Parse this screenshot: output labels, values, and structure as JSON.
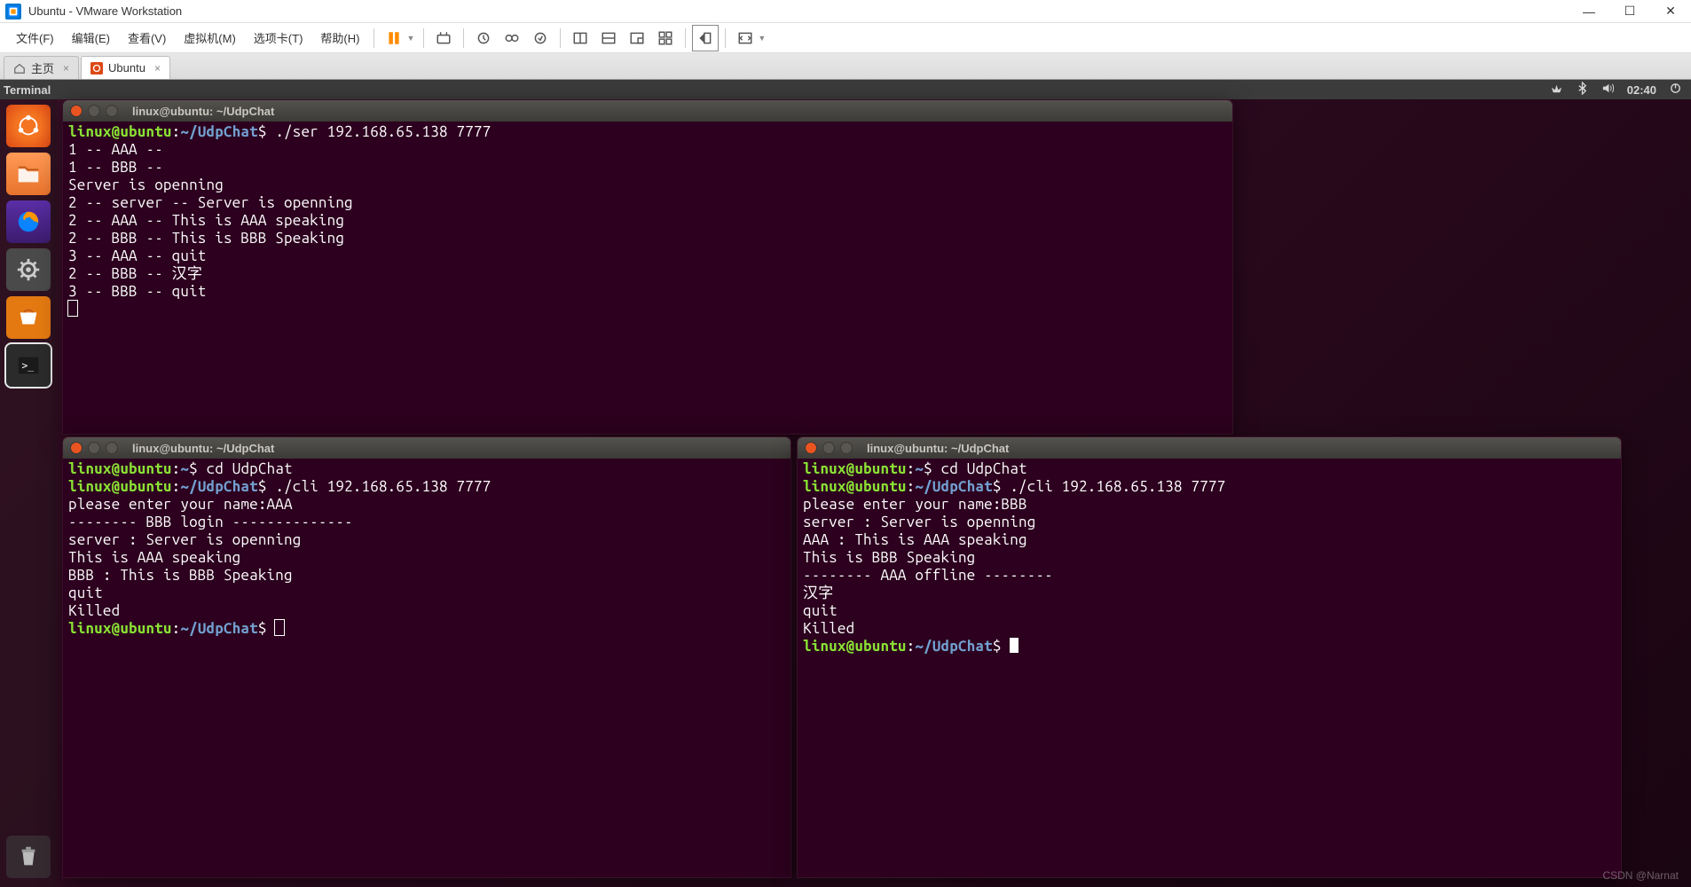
{
  "window": {
    "title": "Ubuntu - VMware Workstation"
  },
  "menu": {
    "file": "文件(F)",
    "edit": "编辑(E)",
    "view": "查看(V)",
    "vm": "虚拟机(M)",
    "tabs_m": "选项卡(T)",
    "help": "帮助(H)"
  },
  "tabs": {
    "home": "主页",
    "ubuntu": "Ubuntu"
  },
  "ubuntu_panel": {
    "app": "Terminal",
    "clock": "02:40"
  },
  "terminals": {
    "a": {
      "title": "linux@ubuntu: ~/UdpChat",
      "host": "linux@ubuntu",
      "path": "~/UdpChat",
      "cmd1": "./ser 192.168.65.138 7777",
      "lines": [
        "1 -- AAA --",
        "1 -- BBB --",
        "Server is openning",
        "2 -- server -- Server is openning",
        "2 -- AAA -- This is AAA speaking",
        "2 -- BBB -- This is BBB Speaking",
        "3 -- AAA -- quit",
        "2 -- BBB -- 汉字",
        "3 -- BBB -- quit"
      ]
    },
    "b": {
      "title": "linux@ubuntu: ~/UdpChat",
      "host": "linux@ubuntu",
      "home": "~",
      "path": "~/UdpChat",
      "cmd0": "cd UdpChat",
      "cmd1": "./cli 192.168.65.138 7777",
      "lines": [
        "please enter your name:AAA",
        "-------- BBB login --------------",
        "server : Server is openning",
        "This is AAA speaking",
        "BBB : This is BBB Speaking",
        "quit",
        "Killed"
      ]
    },
    "c": {
      "title": "linux@ubuntu: ~/UdpChat",
      "host": "linux@ubuntu",
      "home": "~",
      "path": "~/UdpChat",
      "cmd0": "cd UdpChat",
      "cmd1": "./cli 192.168.65.138 7777",
      "lines": [
        "please enter your name:BBB",
        "server : Server is openning",
        "AAA : This is AAA speaking",
        "This is BBB Speaking",
        "-------- AAA offline --------",
        "汉字",
        "quit",
        "Killed"
      ]
    }
  },
  "watermark": "CSDN @Narnat"
}
